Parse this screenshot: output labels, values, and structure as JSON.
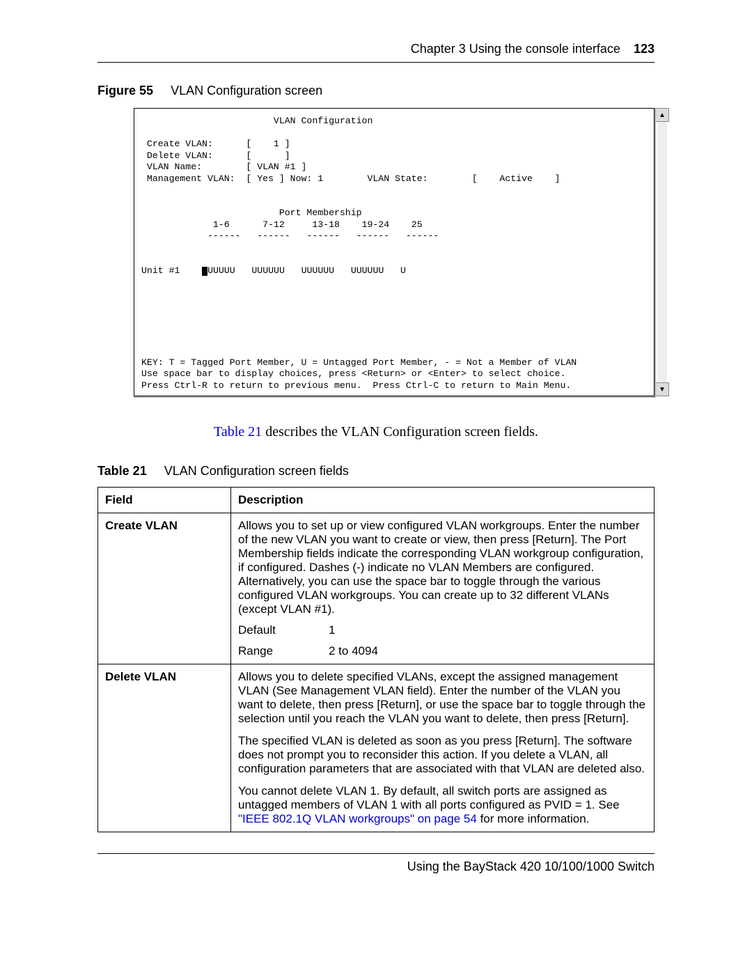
{
  "header": {
    "chapter": "Chapter 3  Using the console interface",
    "pagenum": "123"
  },
  "figure": {
    "label": "Figure 55",
    "title": "VLAN Configuration screen"
  },
  "terminal": {
    "title_line": "                        VLAN Configuration",
    "l1": " Create VLAN:      [    1 ]",
    "l2": " Delete VLAN:      [      ]",
    "l3": " VLAN Name:        [ VLAN #1 ]",
    "l4": " Management VLAN:  [ Yes ] Now: 1        VLAN State:        [    Active    ]",
    "pm1": "                         Port Membership",
    "pm2": "             1-6      7-12     13-18    19-24    25",
    "pm3": "            ------   ------   ------   ------   ------",
    "unit_left": "Unit #1    ",
    "unit_right": "UUUUU   UUUUUU   UUUUUU   UUUUUU   U",
    "key1": "KEY: T = Tagged Port Member, U = Untagged Port Member, - = Not a Member of VLAN",
    "key2": "Use space bar to display choices, press <Return> or <Enter> to select choice.",
    "key3": "Press Ctrl-R to return to previous menu.  Press Ctrl-C to return to Main Menu."
  },
  "scroll": {
    "up": "▲",
    "down": "▼"
  },
  "body_para": {
    "link": "Table 21",
    "rest": " describes the VLAN Configuration screen fields."
  },
  "table_caption": {
    "label": "Table 21",
    "title": "VLAN Configuration screen fields"
  },
  "table": {
    "h1": "Field",
    "h2": "Description",
    "row1": {
      "field": "Create VLAN",
      "desc": "Allows you to set up or view configured VLAN workgroups. Enter the number of the new VLAN you want to create or view, then press [Return]. The Port Membership fields indicate the corresponding VLAN workgroup configuration, if configured. Dashes (-) indicate no VLAN Members are configured. Alternatively, you can use the space bar to toggle through the various configured VLAN workgroups. You can create up to 32 different VLANs (except VLAN #1).",
      "default_k": "Default",
      "default_v": "1",
      "range_k": "Range",
      "range_v": "2 to 4094"
    },
    "row2": {
      "field": "Delete VLAN",
      "p1": "Allows you to delete specified VLANs, except the assigned management VLAN (See Management VLAN field). Enter the number of the VLAN you want to delete, then press [Return], or use the space bar to toggle through the selection until you reach the VLAN you want to delete, then press [Return].",
      "p2": "The specified VLAN is deleted as soon as you press [Return]. The software does not prompt you to reconsider this action. If you delete a VLAN, all configuration parameters that are associated with that VLAN are deleted also.",
      "p3a": "You cannot delete VLAN 1. By default, all switch ports are assigned as untagged members of VLAN 1 with all ports configured as PVID = 1. See ",
      "p3link": "\"IEEE 802.1Q VLAN workgroups\" on page 54",
      "p3b": " for more information."
    }
  },
  "footer": "Using the BayStack 420 10/100/1000 Switch"
}
